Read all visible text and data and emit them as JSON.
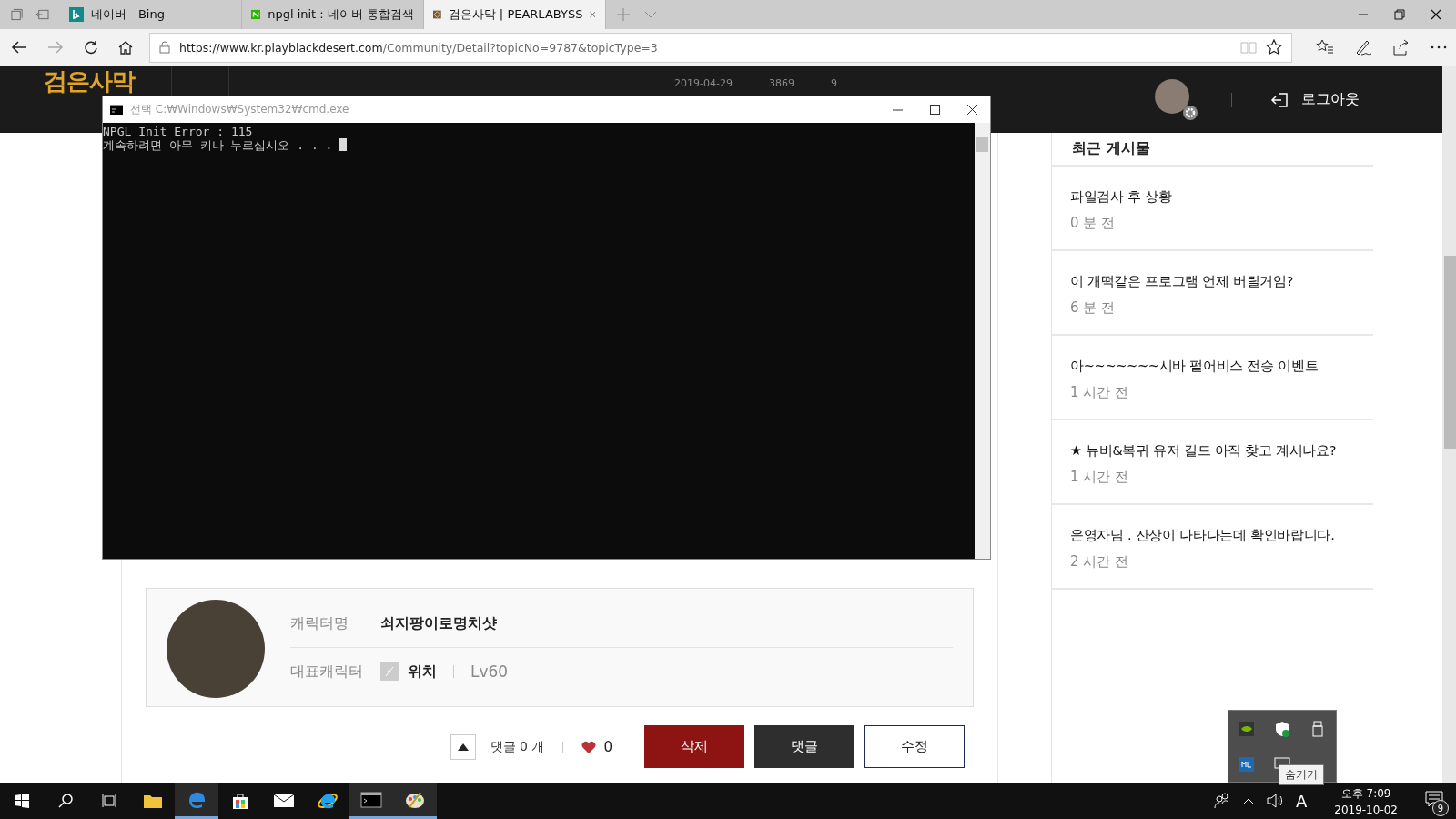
{
  "browser": {
    "tabs": [
      {
        "title": "네이버 - Bing",
        "selected": false
      },
      {
        "title": "npgl init : 네이버 통합검색",
        "selected": false
      },
      {
        "title": "검은사막 | PEARLABYSS",
        "selected": true
      }
    ],
    "url_host": "https://www.kr.playblackdesert.com",
    "url_path": "/Community/Detail?topicNo=9787&topicType=3"
  },
  "site": {
    "logo": "검은사막",
    "header_dim": [
      "2019-04-29",
      "3869",
      "9"
    ],
    "logout": "로그아웃"
  },
  "console": {
    "title": "선택 C:₩Windows₩System32₩cmd.exe",
    "lines": [
      "NPGL Init Error : 115",
      "계속하려면 아무 키나 누르십시오 . . . "
    ]
  },
  "profile": {
    "name_label": "캐릭터명",
    "name": "쇠지팡이로명치샷",
    "main_label": "대표캐릭터",
    "class": "위치",
    "level": "Lv60"
  },
  "actions": {
    "comments": "댓글 0 개",
    "likes": "0",
    "buttons": [
      {
        "label": "삭제",
        "kind": "danger"
      },
      {
        "label": "댓글",
        "kind": "dark"
      },
      {
        "label": "수정",
        "kind": "outline"
      }
    ]
  },
  "sidebar": {
    "title": "최근 게시물",
    "posts": [
      {
        "title": "파일검사 후 상황",
        "time": "0 분 전"
      },
      {
        "title": "이 개떡같은 프로그램 언제 버릴거임?",
        "time": "6 분 전"
      },
      {
        "title": "아~~~~~~~시바 펄어비스 전승 이벤트",
        "time": "1 시간 전"
      },
      {
        "title": "★ 뉴비&복귀 유저 길드 아직 찾고 계시나요?",
        "time": "1 시간 전"
      },
      {
        "title": "운영자님 . 잔상이 나타나는데 확인바랍니다.",
        "time": "2 시간 전"
      }
    ]
  },
  "tray_popup": {
    "tooltip": "숨기기"
  },
  "taskbar": {
    "apps": [
      {
        "kind": "explorer",
        "running": false
      },
      {
        "kind": "edge",
        "running": true
      },
      {
        "kind": "store",
        "running": false
      },
      {
        "kind": "mail",
        "running": false
      },
      {
        "kind": "ie",
        "running": false
      },
      {
        "kind": "cmd",
        "running": true
      },
      {
        "kind": "paint",
        "running": true
      }
    ],
    "ime": "A",
    "time": "오후 7:09",
    "date": "2019-10-02",
    "notifications": "9"
  }
}
